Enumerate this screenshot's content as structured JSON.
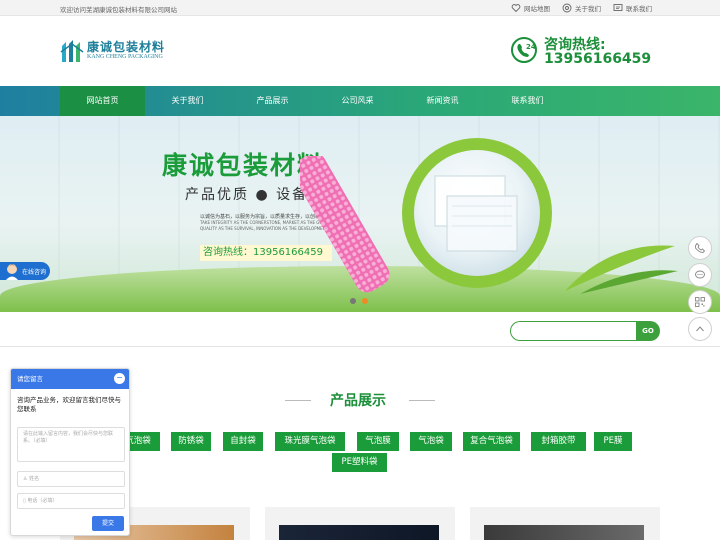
{
  "topbar": {
    "welcome": "欢迎访问芜湖康诚包装材料有限公司网站",
    "links": [
      {
        "label": "网站地图",
        "icon": "heart-icon"
      },
      {
        "label": "关于我们",
        "icon": "at-icon"
      },
      {
        "label": "联系我们",
        "icon": "message-icon"
      }
    ]
  },
  "header": {
    "logo_cn": "康诚包装材料",
    "logo_en": "KANG CHENG PACKAGING",
    "hotline_label": "咨询热线:",
    "hotline_number": "13956166459"
  },
  "nav": {
    "items": [
      "网站首页",
      "关于我们",
      "产品展示",
      "公司风采",
      "新闻资讯",
      "联系我们"
    ],
    "active_index": 0
  },
  "banner": {
    "title": "康诚包装材料",
    "subtitle": "产品优质  ●  设备先进",
    "text_cn": "以诚信为基石，以服务为宗旨，以质量求生存，以创新求发展",
    "text_en1": "TAKE INTEGRITY AS THE CORNERSTONE, MARKET AS THE GUIDE,",
    "text_en2": "QUALITY AS THE SURVIVAL, INNOVATION AS THE DEVELOPMENT",
    "hotline": "咨询热线：13956166459",
    "slides": 2,
    "active_slide": 1
  },
  "online_chat": "在线咨询",
  "search": {
    "placeholder": "",
    "button": "GO"
  },
  "section": {
    "title": "产品展示"
  },
  "tags": [
    "气泡袋",
    "防锈袋",
    "自封袋",
    "珠光膜气泡袋",
    "气泡膜",
    "气泡袋",
    "复合气泡袋",
    "封箱胶带",
    "PE膜",
    "PE塑料袋"
  ],
  "message_box": {
    "header": "请您留言",
    "minimize": "−",
    "intro": "咨询产品业务，欢迎留言我们尽快与您联系",
    "textarea_placeholder": "请在此输入留言内容，我们会尽快与您联系。（必填）",
    "name_placeholder": "姓名",
    "phone_placeholder": "电话（必填）",
    "submit": "提交"
  },
  "colors": {
    "brand_green": "#1b9c3a",
    "nav_blue": "#1f7fa0",
    "chat_blue": "#3b78e7"
  }
}
